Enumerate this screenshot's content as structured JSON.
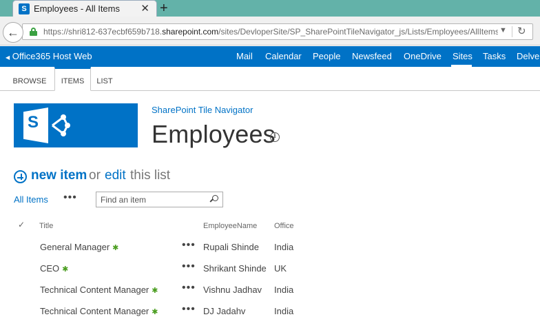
{
  "browser": {
    "tab_title": "Employees - All Items",
    "tab_favicon": "S",
    "url_prefix": "https://shri812-637ecbf659b718.",
    "url_domain": "sharepoint.com",
    "url_path": "/sites/DevloperSite/SP_SharePointTileNavigator_js/Lists/Employees/AllItems",
    "new_tab_symbol": "+",
    "close_symbol": "✕"
  },
  "suitebar": {
    "title": "Office365 Host Web",
    "links": [
      "Mail",
      "Calendar",
      "People",
      "Newsfeed",
      "OneDrive",
      "Sites",
      "Tasks",
      "Delve"
    ],
    "active": "Sites"
  },
  "ribbon": {
    "tabs": [
      "BROWSE",
      "ITEMS",
      "LIST"
    ],
    "active": "ITEMS"
  },
  "page": {
    "site_title": "SharePoint Tile Navigator",
    "list_title": "Employees",
    "logo_letter": "S"
  },
  "hero": {
    "new_item": "new item",
    "or": "or",
    "edit": "edit",
    "this_list": "this list"
  },
  "view": {
    "current_view": "All Items",
    "search_placeholder": "Find an item"
  },
  "list": {
    "columns": [
      "Title",
      "EmployeeName",
      "Office"
    ],
    "rows": [
      {
        "title": "General Manager",
        "name": "Rupali Shinde",
        "office": "India"
      },
      {
        "title": "CEO",
        "name": "Shrikant Shinde",
        "office": "UK"
      },
      {
        "title": "Technical Content Manager",
        "name": "Vishnu Jadhav",
        "office": "India"
      },
      {
        "title": "Technical Content Manager",
        "name": "DJ Jadahv",
        "office": "India"
      }
    ]
  },
  "icons": {
    "new_badge": "✱",
    "ellipsis": "•••"
  },
  "colors": {
    "brand": "#0072c6",
    "tab_strip": "#63b2a9",
    "new_badge": "#4a9d1f"
  }
}
